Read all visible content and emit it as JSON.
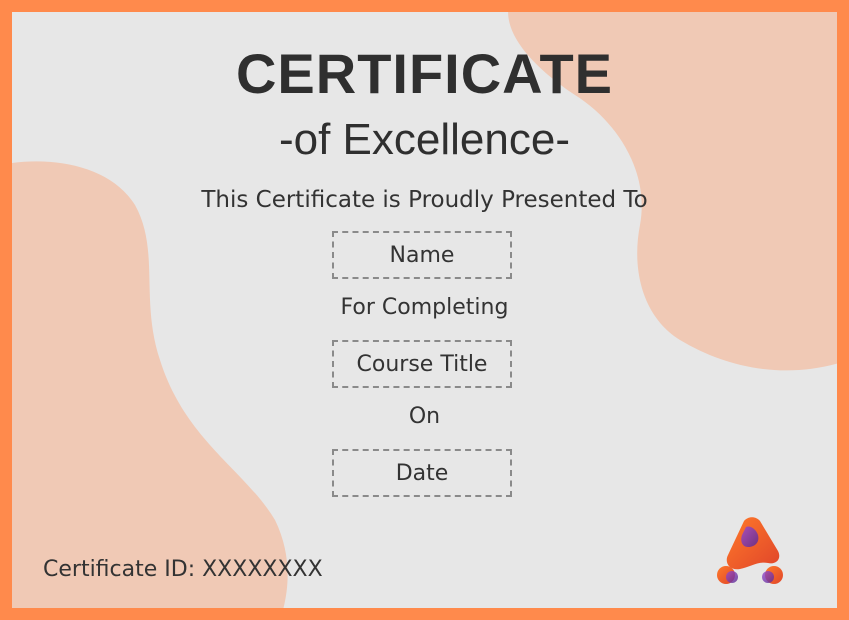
{
  "certificate": {
    "title": "CERTIFICATE",
    "subtitle": "-of Excellence-",
    "presented_text": "This Certificate is Proudly Presented To",
    "name_placeholder": "Name",
    "completing_text": "For Completing",
    "course_placeholder": "Course Title",
    "on_text": "On",
    "date_placeholder": "Date",
    "certificate_id": "Certificate ID: XXXXXXXX"
  },
  "colors": {
    "border": "#ff8a4c",
    "background": "#e7e7e7",
    "blob": "#f0c9b5",
    "text": "#333333",
    "logo_orange": "#ff6a2a",
    "logo_purple": "#7a3fb0"
  },
  "logo": {
    "icon": "brand-logo-icon"
  }
}
